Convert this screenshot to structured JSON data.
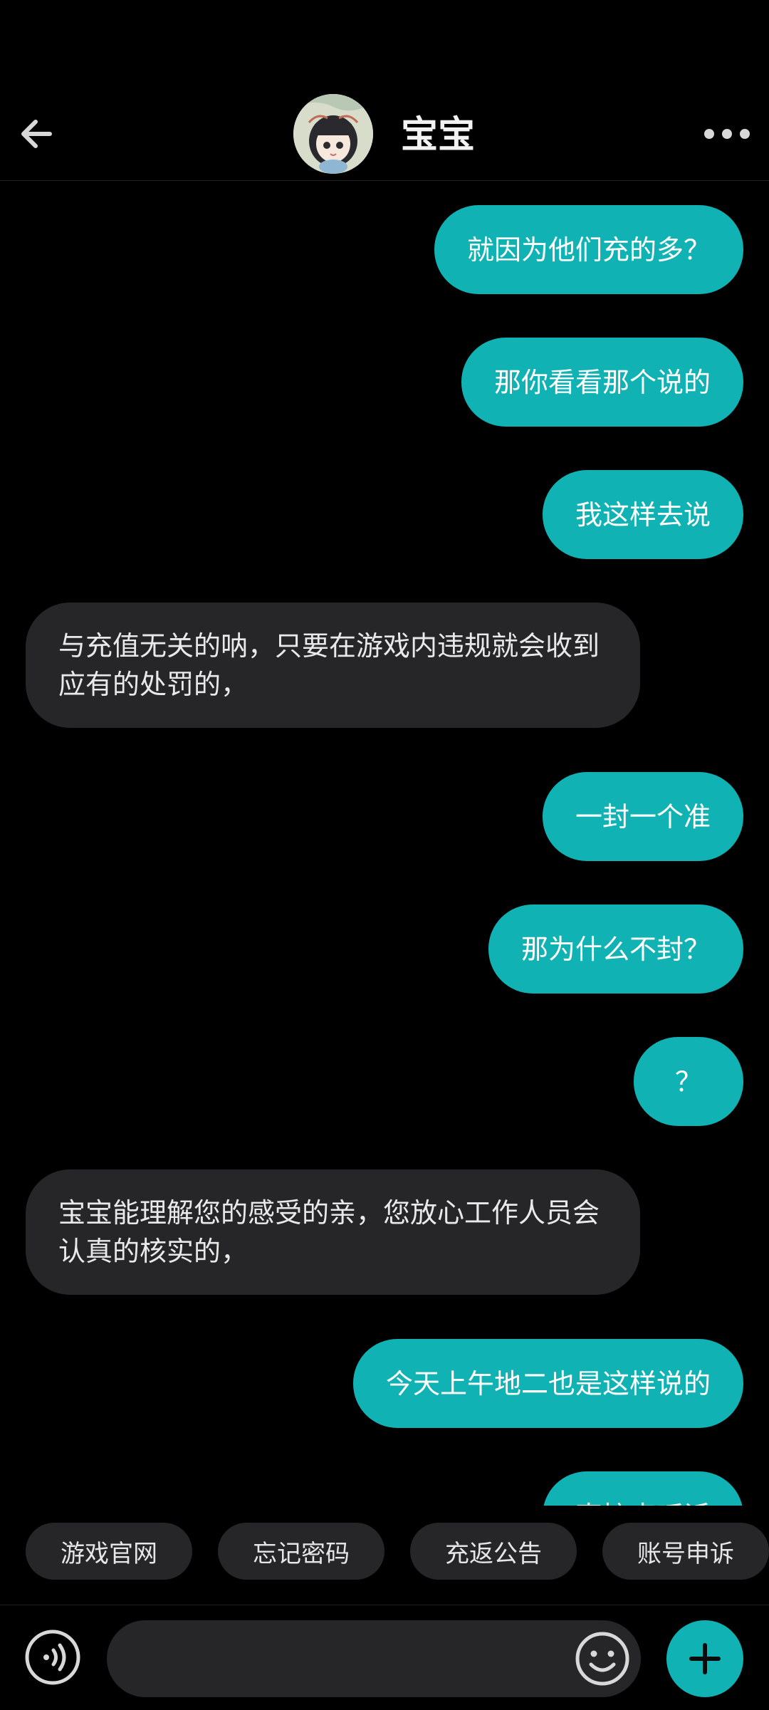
{
  "header": {
    "title": "宝宝"
  },
  "messages": [
    {
      "dir": "out",
      "text": "就因为他们充的多？"
    },
    {
      "dir": "out",
      "text": "那你看看那个说的"
    },
    {
      "dir": "out",
      "text": "我这样去说"
    },
    {
      "dir": "in",
      "text": "与充值无关的呐，只要在游戏内违规就会收到应有的处罚的，"
    },
    {
      "dir": "out",
      "text": "一封一个准"
    },
    {
      "dir": "out",
      "text": "那为什么不封？"
    },
    {
      "dir": "out",
      "text": "？"
    },
    {
      "dir": "in",
      "text": "宝宝能理解您的感受的亲，您放心工作人员会认真的核实的，"
    },
    {
      "dir": "out",
      "text": "今天上午地二也是这样说的"
    },
    {
      "dir": "out",
      "text": "直接点呼诉"
    }
  ],
  "quick_replies": [
    "游戏官网",
    "忘记密码",
    "充返公告",
    "账号申诉"
  ],
  "input": {
    "value": "",
    "placeholder": ""
  },
  "colors": {
    "accent": "#10b2b4",
    "incoming_bubble": "#262629",
    "background": "#000000"
  },
  "icons": {
    "back": "arrow-left-icon",
    "more": "more-dots-icon",
    "voice": "voice-icon",
    "emoji": "emoji-icon",
    "plus": "plus-icon"
  }
}
